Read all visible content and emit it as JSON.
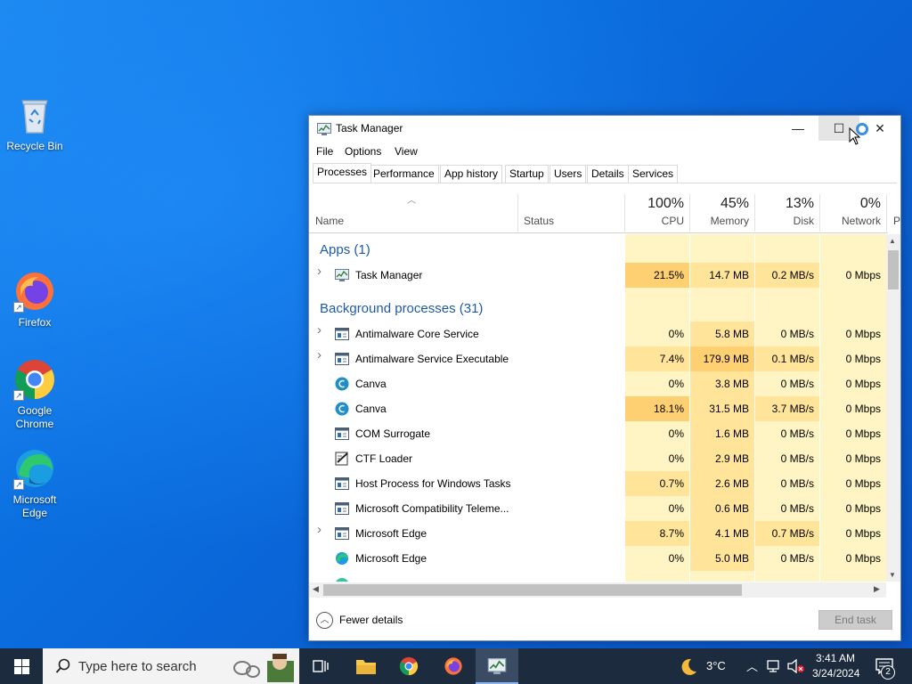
{
  "desktop": {
    "icons": [
      {
        "label": "Recycle Bin",
        "icon": "recycle-bin-icon"
      },
      {
        "label": "Firefox",
        "icon": "firefox-icon"
      },
      {
        "label": "Google Chrome",
        "icon": "chrome-icon"
      },
      {
        "label": "Microsoft Edge",
        "icon": "edge-icon"
      }
    ]
  },
  "window": {
    "title": "Task Manager",
    "controls": {
      "minimize": "—",
      "maximize": "☐",
      "close": "✕"
    },
    "menu": [
      "File",
      "Options",
      "View"
    ],
    "tabs": [
      "Processes",
      "Performance",
      "App history",
      "Startup",
      "Users",
      "Details",
      "Services"
    ],
    "active_tab": "Processes",
    "columns": {
      "name": "Name",
      "status": "Status",
      "cpu": {
        "pct": "100%",
        "label": "CPU"
      },
      "memory": {
        "pct": "45%",
        "label": "Memory"
      },
      "disk": {
        "pct": "13%",
        "label": "Disk"
      },
      "network": {
        "pct": "0%",
        "label": "Network"
      },
      "power": "P"
    },
    "groups": {
      "apps": "Apps (1)",
      "background": "Background processes (31)"
    },
    "apps": [
      {
        "name": "Task Manager",
        "cpu": "21.5%",
        "memory": "14.7 MB",
        "disk": "0.2 MB/s",
        "network": "0 Mbps",
        "expandable": true,
        "icon": "task-manager-icon"
      }
    ],
    "processes": [
      {
        "name": "Antimalware Core Service",
        "cpu": "0%",
        "memory": "5.8 MB",
        "disk": "0 MB/s",
        "network": "0 Mbps",
        "expandable": true,
        "icon": "service-icon"
      },
      {
        "name": "Antimalware Service Executable",
        "cpu": "7.4%",
        "memory": "179.9 MB",
        "disk": "0.1 MB/s",
        "network": "0 Mbps",
        "expandable": true,
        "icon": "service-icon"
      },
      {
        "name": "Canva",
        "cpu": "0%",
        "memory": "3.8 MB",
        "disk": "0 MB/s",
        "network": "0 Mbps",
        "expandable": false,
        "icon": "canva-icon"
      },
      {
        "name": "Canva",
        "cpu": "18.1%",
        "memory": "31.5 MB",
        "disk": "3.7 MB/s",
        "network": "0 Mbps",
        "expandable": false,
        "icon": "canva-icon"
      },
      {
        "name": "COM Surrogate",
        "cpu": "0%",
        "memory": "1.6 MB",
        "disk": "0 MB/s",
        "network": "0 Mbps",
        "expandable": false,
        "icon": "service-icon"
      },
      {
        "name": "CTF Loader",
        "cpu": "0%",
        "memory": "2.9 MB",
        "disk": "0 MB/s",
        "network": "0 Mbps",
        "expandable": false,
        "icon": "ctf-loader-icon"
      },
      {
        "name": "Host Process for Windows Tasks",
        "cpu": "0.7%",
        "memory": "2.6 MB",
        "disk": "0 MB/s",
        "network": "0 Mbps",
        "expandable": false,
        "icon": "service-icon"
      },
      {
        "name": "Microsoft Compatibility Teleme...",
        "cpu": "0%",
        "memory": "0.6 MB",
        "disk": "0 MB/s",
        "network": "0 Mbps",
        "expandable": false,
        "icon": "service-icon"
      },
      {
        "name": "Microsoft Edge",
        "cpu": "8.7%",
        "memory": "4.1 MB",
        "disk": "0.7 MB/s",
        "network": "0 Mbps",
        "expandable": true,
        "icon": "service-icon"
      },
      {
        "name": "Microsoft Edge",
        "cpu": "0%",
        "memory": "5.0 MB",
        "disk": "0 MB/s",
        "network": "0 Mbps",
        "expandable": false,
        "icon": "edge-icon"
      }
    ],
    "footer": {
      "fewer_details": "Fewer details",
      "end_task": "End task"
    }
  },
  "taskbar": {
    "search_placeholder": "Type here to search",
    "weather": "3°C",
    "time": "3:41 AM",
    "date": "3/24/2024",
    "notification_count": "2"
  },
  "colors": {
    "accent": "#1e5aa8",
    "heat_low": "#fff4c4",
    "heat_mid": "#ffe49a",
    "heat_high": "#ffd071",
    "taskbar": "#1c2b3d"
  }
}
